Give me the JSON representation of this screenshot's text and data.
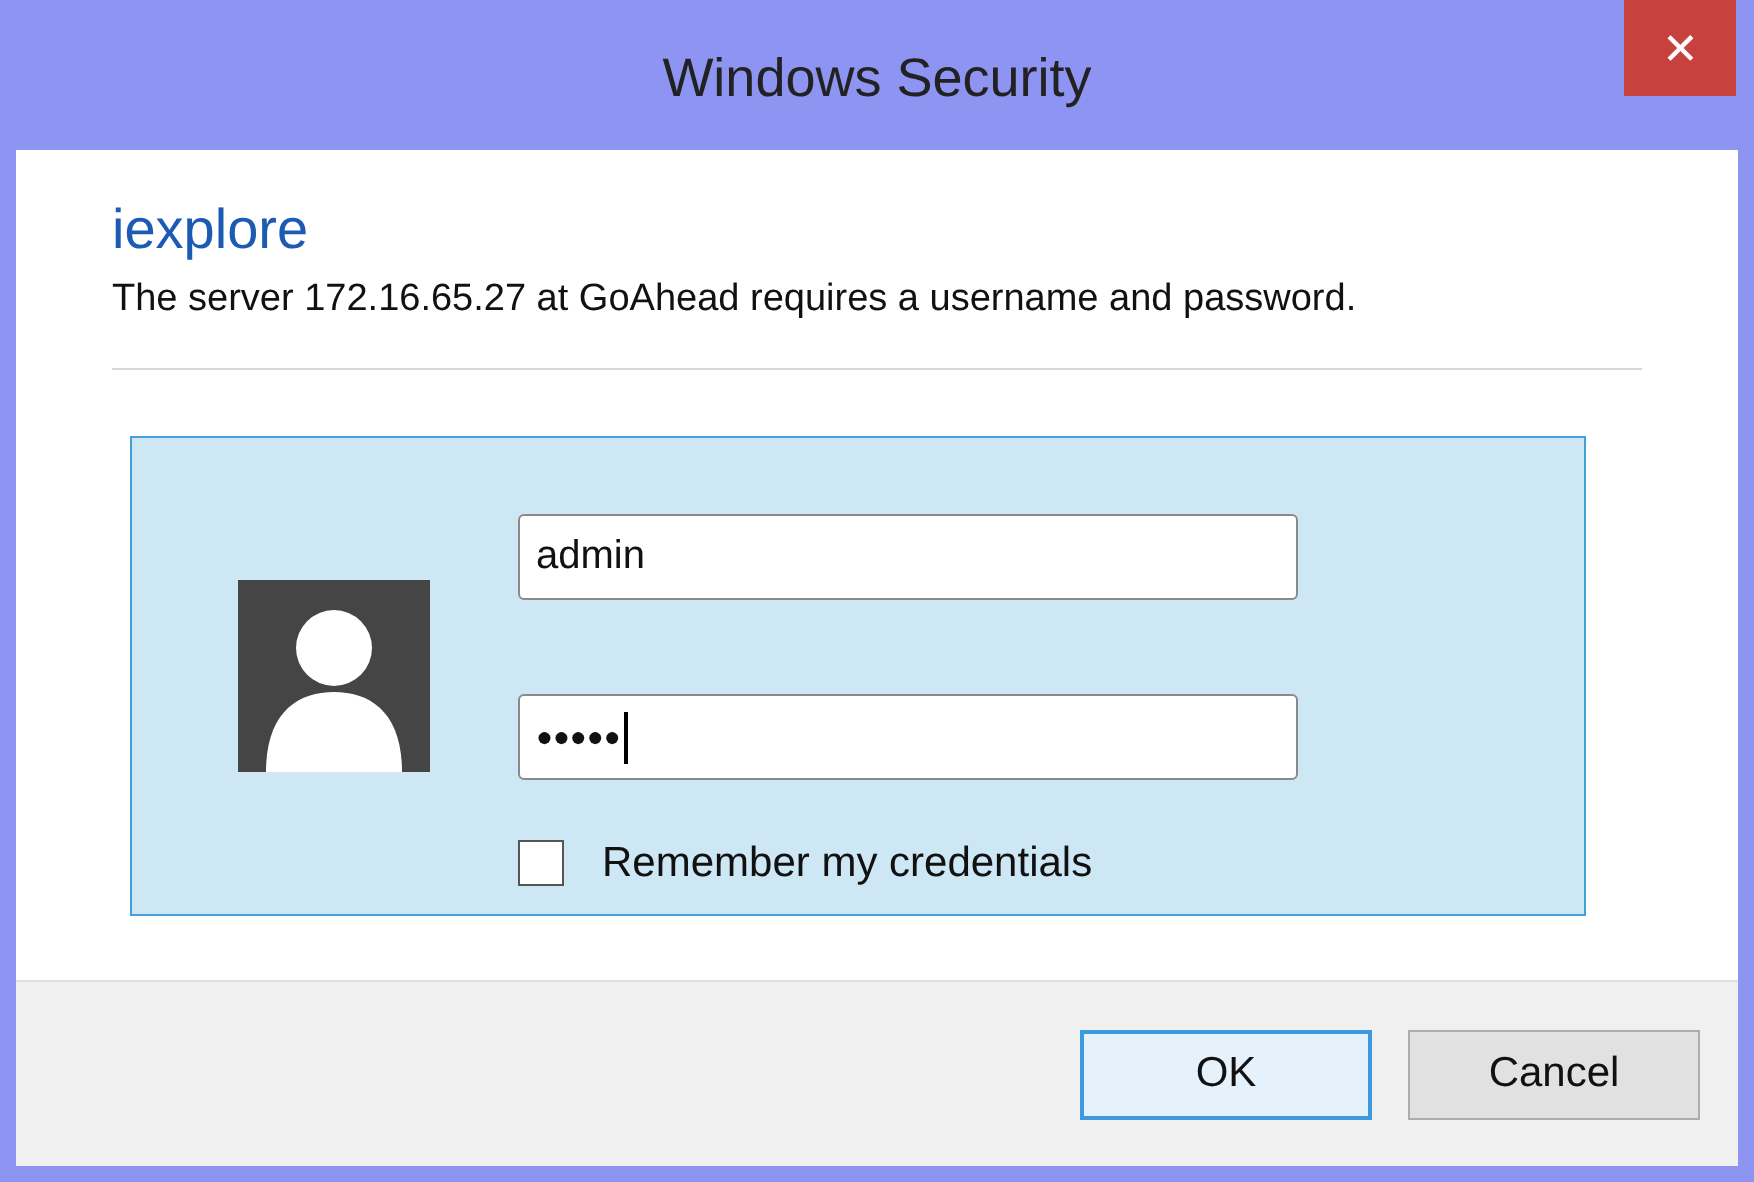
{
  "window": {
    "title": "Windows Security",
    "close": "✕"
  },
  "app_name": "iexplore",
  "message": "The server 172.16.65.27 at GoAhead requires a username and password.",
  "username": {
    "value": "admin"
  },
  "password": {
    "value": "●●●●●",
    "focused": true
  },
  "remember": {
    "label": "Remember my credentials",
    "checked": false
  },
  "buttons": [
    {
      "label": "OK",
      "default": true
    },
    {
      "label": "Cancel",
      "default": false
    }
  ]
}
